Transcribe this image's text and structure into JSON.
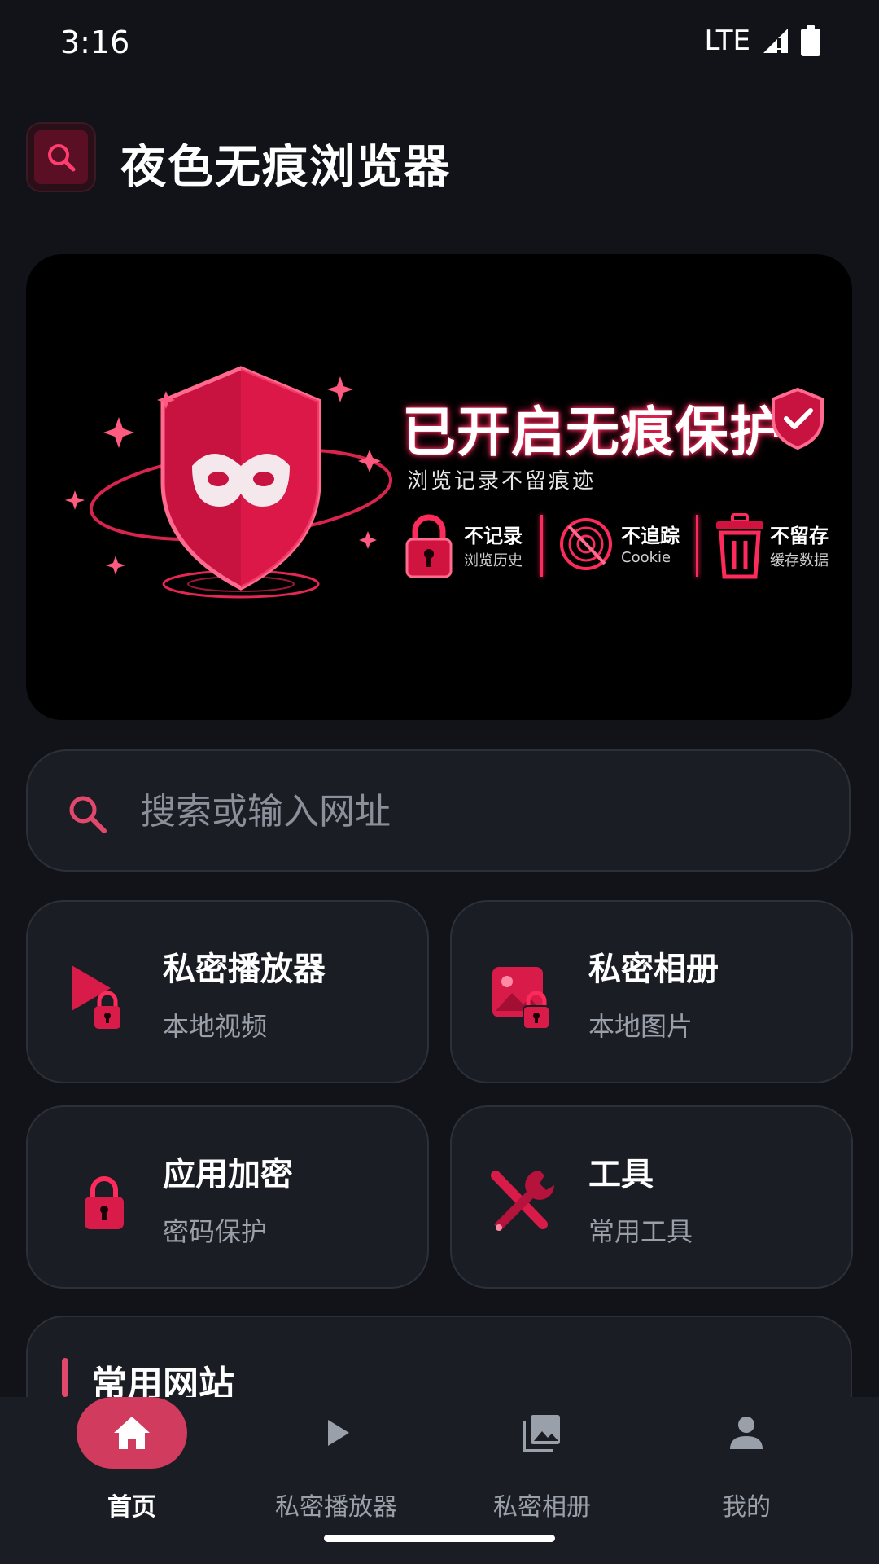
{
  "status": {
    "time": "3:16",
    "network": "LTE"
  },
  "app": {
    "title": "夜色无痕浏览器"
  },
  "banner": {
    "title": "已开启无痕保护",
    "subtitle": "浏览记录不留痕迹",
    "features": [
      {
        "main": "不记录",
        "sub": "浏览历史",
        "icon": "lock-icon"
      },
      {
        "main": "不追踪",
        "sub": "Cookie",
        "icon": "no-tracking-icon"
      },
      {
        "main": "不留存",
        "sub": "缓存数据",
        "icon": "trash-icon"
      }
    ]
  },
  "search": {
    "placeholder": "搜索或输入网址"
  },
  "cards": [
    {
      "title": "私密播放器",
      "sub": "本地视频",
      "icon": "private-player-icon"
    },
    {
      "title": "私密相册",
      "sub": "本地图片",
      "icon": "private-album-icon"
    },
    {
      "title": "应用加密",
      "sub": "密码保护",
      "icon": "app-lock-icon"
    },
    {
      "title": "工具",
      "sub": "常用工具",
      "icon": "tools-icon"
    }
  ],
  "sites": {
    "title": "常用网站"
  },
  "nav": [
    {
      "label": "首页",
      "icon": "home-icon",
      "active": true
    },
    {
      "label": "私密播放器",
      "icon": "play-icon",
      "active": false
    },
    {
      "label": "私密相册",
      "icon": "photo-library-icon",
      "active": false
    },
    {
      "label": "我的",
      "icon": "person-icon",
      "active": false
    }
  ],
  "colors": {
    "accent": "#ff2a5c",
    "nav_active": "#d03b5e",
    "background": "#111318",
    "card": "#1a1d24"
  }
}
